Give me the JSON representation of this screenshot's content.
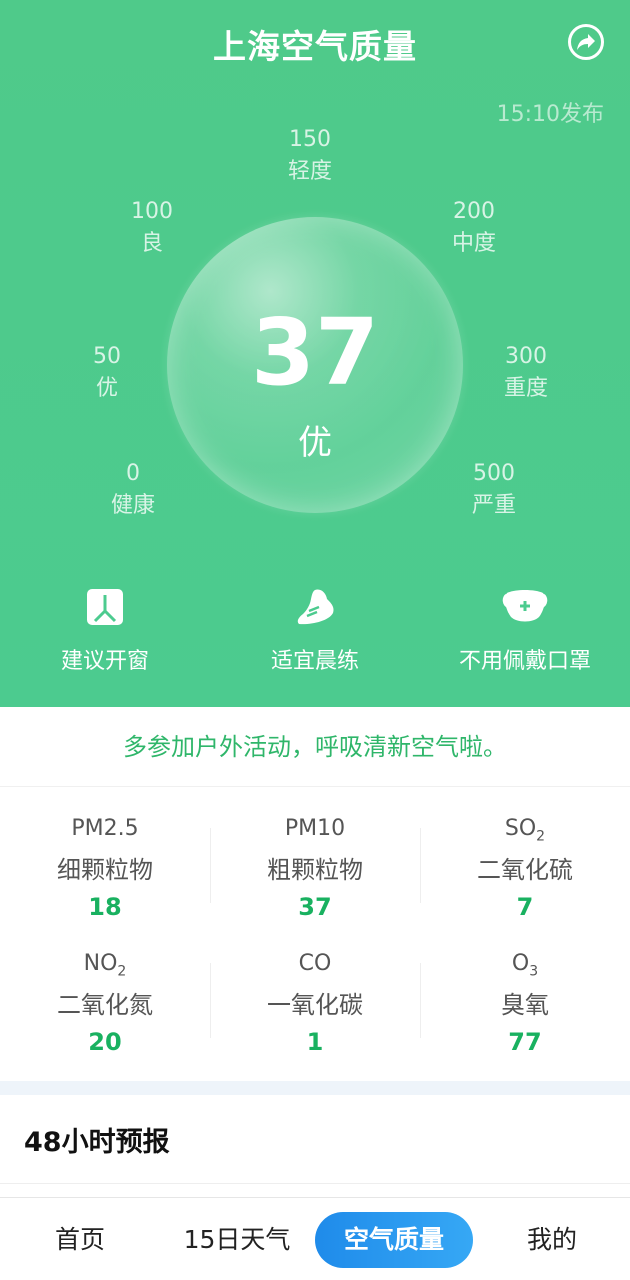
{
  "header": {
    "title": "上海空气质量",
    "publish_time": "15:10发布",
    "share_icon": "share-icon"
  },
  "aqi": {
    "value": "37",
    "level": "优"
  },
  "scale": [
    {
      "num": "0",
      "label": "健康"
    },
    {
      "num": "50",
      "label": "优"
    },
    {
      "num": "100",
      "label": "良"
    },
    {
      "num": "150",
      "label": "轻度"
    },
    {
      "num": "200",
      "label": "中度"
    },
    {
      "num": "300",
      "label": "重度"
    },
    {
      "num": "500",
      "label": "严重"
    }
  ],
  "tips": [
    {
      "icon": "window-icon",
      "label": "建议开窗"
    },
    {
      "icon": "running-shoe-icon",
      "label": "适宜晨练"
    },
    {
      "icon": "mask-icon",
      "label": "不用佩戴口罩"
    }
  ],
  "slogan": "多参加户外活动，呼吸清新空气啦。",
  "pollutants": [
    {
      "code": "PM2.5",
      "code_sub": "",
      "name": "细颗粒物",
      "value": "18"
    },
    {
      "code": "PM10",
      "code_sub": "",
      "name": "粗颗粒物",
      "value": "37"
    },
    {
      "code": "SO",
      "code_sub": "2",
      "name": "二氧化硫",
      "value": "7"
    },
    {
      "code": "NO",
      "code_sub": "2",
      "name": "二氧化氮",
      "value": "20"
    },
    {
      "code": "CO",
      "code_sub": "",
      "name": "一氧化碳",
      "value": "1"
    },
    {
      "code": "O",
      "code_sub": "3",
      "name": "臭氧",
      "value": "77"
    }
  ],
  "forecast": {
    "title": "48小时预报"
  },
  "nav": [
    {
      "label": "首页"
    },
    {
      "label": "15日天气"
    },
    {
      "label": "空气质量",
      "active": true
    },
    {
      "label": "我的"
    }
  ],
  "colors": {
    "hero_green": "#4ccb8f",
    "value_green": "#19b160",
    "nav_active_blue": "#1f8bea"
  }
}
